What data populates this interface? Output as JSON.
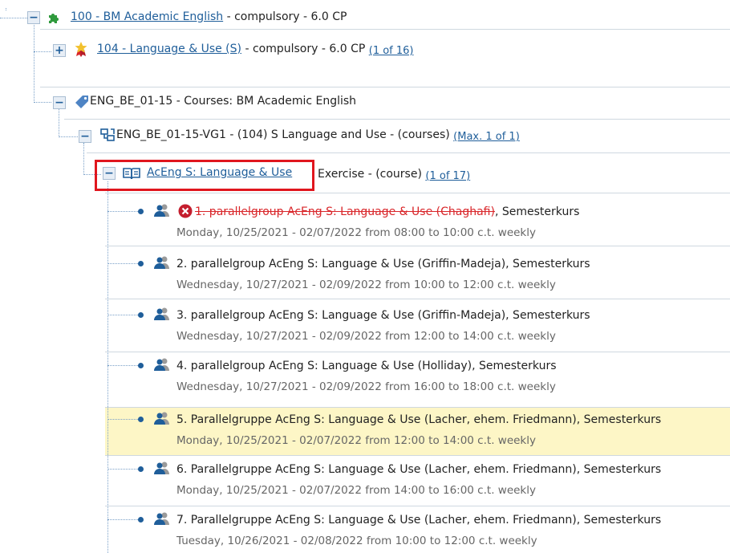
{
  "tree": {
    "root": {
      "link": "100 - BM Academic English",
      "suffix": " - compulsory - 6.0 CP"
    },
    "module": {
      "link": "104 - Language & Use (S)",
      "suffix": " - compulsory - 6.0 CP",
      "count": "(1 of 16)"
    },
    "courses_node": {
      "label": "ENG_BE_01-15 - Courses: BM Academic English"
    },
    "group_node": {
      "label": "ENG_BE_01-15-VG1 - (104) S Language and Use - (courses)",
      "count": "(Max. 1 of 1)"
    },
    "course": {
      "link": "AcEng S: Language & Use",
      "suffix": "Exercise - (course)",
      "count": "(1 of 17)"
    },
    "groups": [
      {
        "title": "1. parallelgroup AcEng S: Language & Use (Chaghafi)",
        "after": ", Semesterkurs",
        "schedule": "Monday, 10/25/2021 - 02/07/2022 from 08:00 to 10:00 c.t. weekly",
        "cancelled": true
      },
      {
        "title": "2. parallelgroup AcEng S: Language & Use (Griffin-Madeja), Semesterkurs",
        "schedule": "Wednesday, 10/27/2021 - 02/09/2022 from 10:00 to 12:00 c.t. weekly"
      },
      {
        "title": "3. parallelgroup AcEng S: Language & Use (Griffin-Madeja), Semesterkurs",
        "schedule": "Wednesday, 10/27/2021 - 02/09/2022 from 12:00 to 14:00 c.t. weekly"
      },
      {
        "title": "4. parallelgroup AcEng S: Language & Use (Holliday), Semesterkurs",
        "schedule": "Wednesday, 10/27/2021 - 02/09/2022 from 16:00 to 18:00 c.t. weekly"
      },
      {
        "title": "5. Parallelgruppe AcEng S: Language & Use (Lacher, ehem. Friedmann), Semesterkurs",
        "schedule": "Monday, 10/25/2021 - 02/07/2022 from 12:00 to 14:00 c.t. weekly",
        "highlighted": true
      },
      {
        "title": "6. Parallelgruppe AcEng S: Language & Use (Lacher, ehem. Friedmann), Semesterkurs",
        "schedule": "Monday, 10/25/2021 - 02/07/2022 from 14:00 to 16:00 c.t. weekly"
      },
      {
        "title": "7. Parallelgruppe AcEng S: Language & Use (Lacher, ehem. Friedmann), Semesterkurs",
        "schedule": "Tuesday, 10/26/2021 - 02/08/2022 from 10:00 to 12:00 c.t. weekly"
      }
    ]
  },
  "icons": {
    "root": "puzzle-icon",
    "module": "badge-icon",
    "courses_node": "tag-icon",
    "group_node": "group-structure-icon",
    "course": "book-icon",
    "group": "people-icon",
    "cancelled": "cancel-icon"
  },
  "colors": {
    "link": "#1f5e9a",
    "cancelled": "#d9262a",
    "highlight": "#fdf6c6",
    "selection_box": "#e0161e"
  }
}
